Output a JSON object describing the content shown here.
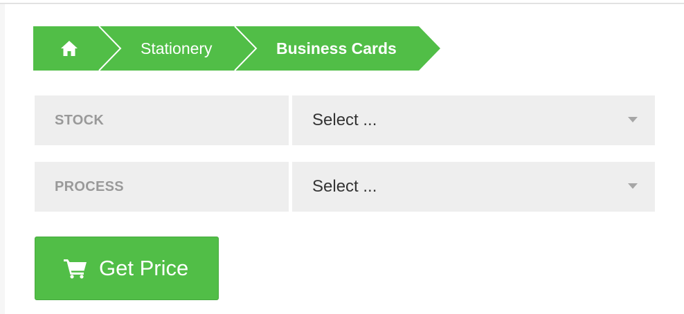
{
  "colors": {
    "accent_green": "#51be47",
    "field_background": "#eeeeee",
    "label_text": "#999999",
    "select_text": "#333333"
  },
  "breadcrumb": {
    "home_icon": "home-icon",
    "items": [
      {
        "label": "Stationery"
      },
      {
        "label": "Business Cards"
      }
    ]
  },
  "form": {
    "stock": {
      "label": "STOCK",
      "value": "Select ..."
    },
    "process": {
      "label": "PROCESS",
      "value": "Select ..."
    }
  },
  "actions": {
    "get_price_label": "Get Price",
    "get_price_icon": "cart-icon"
  }
}
